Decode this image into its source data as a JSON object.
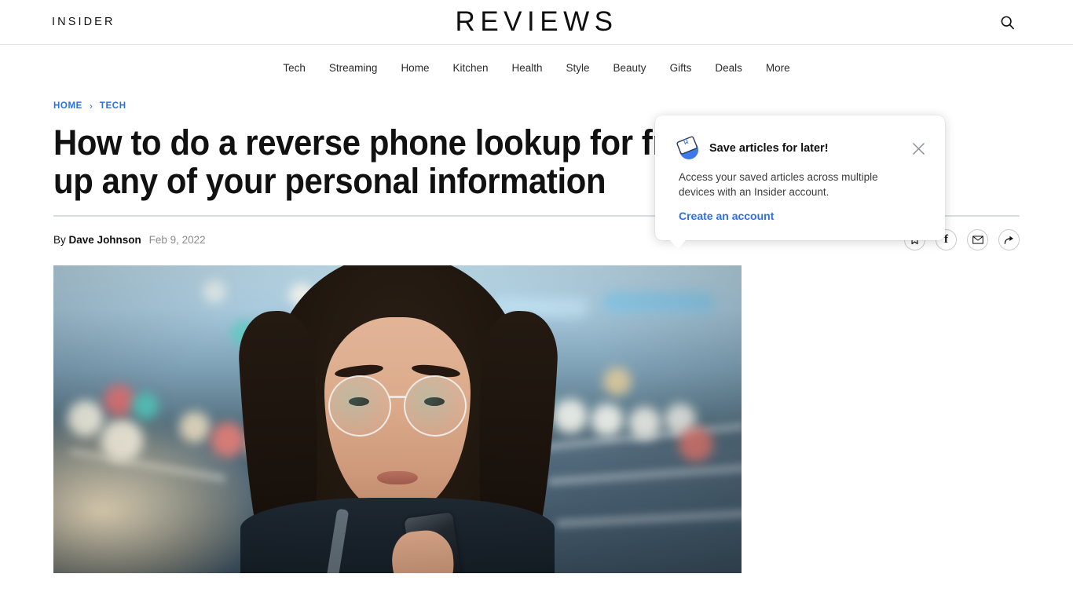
{
  "masthead": {
    "brand": "INSIDER",
    "vertical": "REVIEWS",
    "search_icon": "search-icon"
  },
  "nav": {
    "items": [
      {
        "label": "Tech"
      },
      {
        "label": "Streaming"
      },
      {
        "label": "Home"
      },
      {
        "label": "Kitchen"
      },
      {
        "label": "Health"
      },
      {
        "label": "Style"
      },
      {
        "label": "Beauty"
      },
      {
        "label": "Gifts"
      },
      {
        "label": "Deals"
      },
      {
        "label": "More"
      }
    ]
  },
  "article": {
    "breadcrumb": {
      "home": "HOME",
      "separator": "›",
      "section": "TECH"
    },
    "headline": "How to do a reverse phone lookup for free without giving up any of your personal information",
    "byline_prefix": "By",
    "author": "Dave Johnson",
    "date": "Feb 9, 2022",
    "share": [
      {
        "name": "bookmark-icon",
        "label": "Save"
      },
      {
        "name": "facebook-icon",
        "label": "f"
      },
      {
        "name": "email-icon",
        "label": "Email"
      },
      {
        "name": "share-arrow-icon",
        "label": "Share"
      }
    ],
    "hero_alt": "Woman wearing glasses looking at a smartphone on a city street at night with colorful bokeh lights"
  },
  "popup": {
    "icon": "save-articles-icon",
    "title": "Save articles for later!",
    "body": "Access your saved articles across multiple devices with an Insider account.",
    "link": "Create an account",
    "close_icon": "close-icon"
  },
  "colors": {
    "link_blue": "#2f6fe4",
    "text_dark": "#111111",
    "muted_gray": "#8b8b8b",
    "rule_gray": "#d9dde2"
  }
}
